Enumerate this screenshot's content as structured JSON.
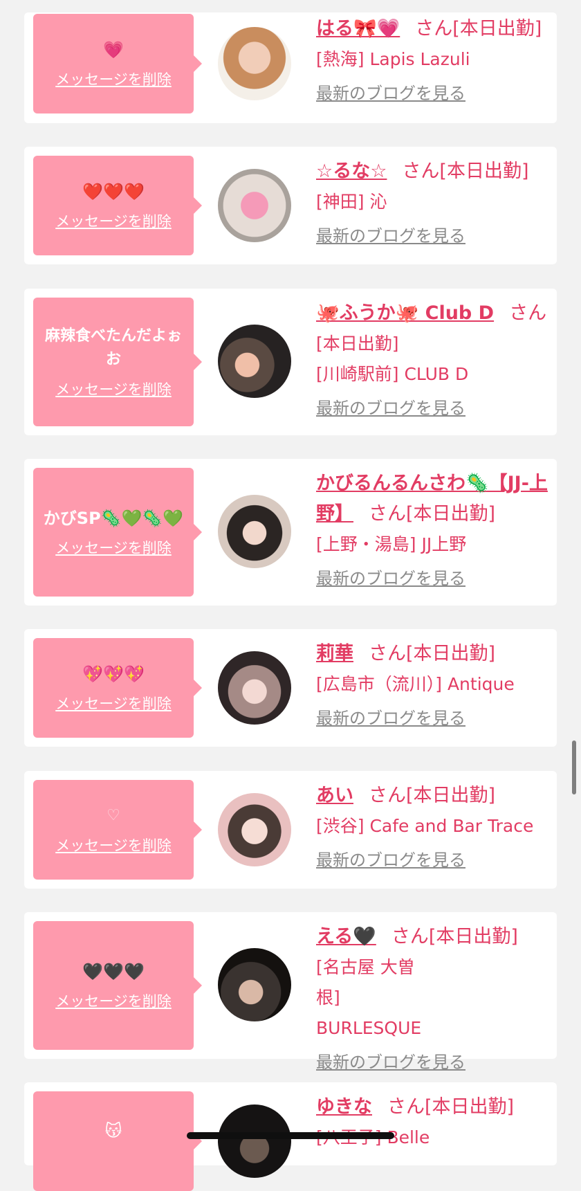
{
  "common": {
    "san": "さん",
    "status": "[本日出勤]",
    "delete_label": "メッセージを削除",
    "blog_label": "最新のブログを見る"
  },
  "entries": [
    {
      "message": "💗",
      "name": "はる🎀💗",
      "shop": "[熱海] Lapis Lazuli",
      "status": "[本日出勤]"
    },
    {
      "message": "❤️❤️❤️",
      "name": "☆るな☆",
      "shop": "[神田] 沁",
      "status": "[本日出勤]"
    },
    {
      "message": "麻辣食べたんだよぉお",
      "name": "🐙ふうか🐙 Club D",
      "shop": "[川崎駅前] CLUB D",
      "status": "[本日出勤]"
    },
    {
      "message": "かびSP🦠💚🦠💚",
      "name": "かびるんるんさわ🦠【JJ-上野】",
      "shop": "[上野・湯島] JJ上野",
      "status": "[本日出勤]"
    },
    {
      "message": "💖💖💖",
      "name": "莉華",
      "shop": "[広島市（流川）] Antique",
      "status": "[本日出勤]"
    },
    {
      "message": "♡",
      "name": "あい",
      "shop": "[渋谷] Cafe and Bar Trace",
      "status": "[本日出勤]"
    },
    {
      "message": "🖤🖤🖤",
      "name": "える🖤",
      "shop": "[名古屋 大曽根] BURLESQUE",
      "status": "[本日出勤]"
    },
    {
      "message": "😽",
      "name": "ゆきな",
      "shop": "[八王子] Belle",
      "status": "[本日出勤]"
    }
  ],
  "colors": {
    "bubble": "#fe9aad",
    "accent": "#e23c63",
    "link_gray": "#8a8a8a",
    "background": "#f2f2f2"
  }
}
